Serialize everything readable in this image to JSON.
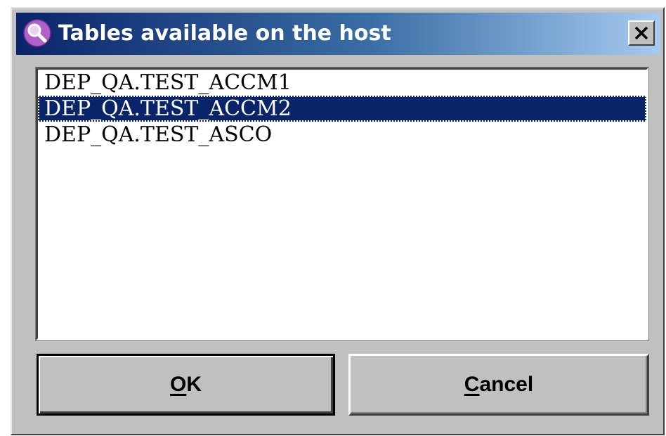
{
  "dialog": {
    "title": "Tables available on the host",
    "icon": "magnifier-icon",
    "close_icon": "close-icon"
  },
  "table_list": {
    "items": [
      {
        "label": "DEP_QA.TEST_ACCM1",
        "selected": false
      },
      {
        "label": "DEP_QA.TEST_ACCM2",
        "selected": true
      },
      {
        "label": "DEP_QA.TEST_ASCO",
        "selected": false
      }
    ]
  },
  "buttons": {
    "ok": {
      "mnemonic": "O",
      "rest": "K"
    },
    "cancel": {
      "mnemonic": "C",
      "rest": "ancel"
    }
  },
  "colors": {
    "selection": "#0a246a",
    "title_start": "#0a246a",
    "title_end": "#a6caf0",
    "face": "#c0c0c0"
  }
}
